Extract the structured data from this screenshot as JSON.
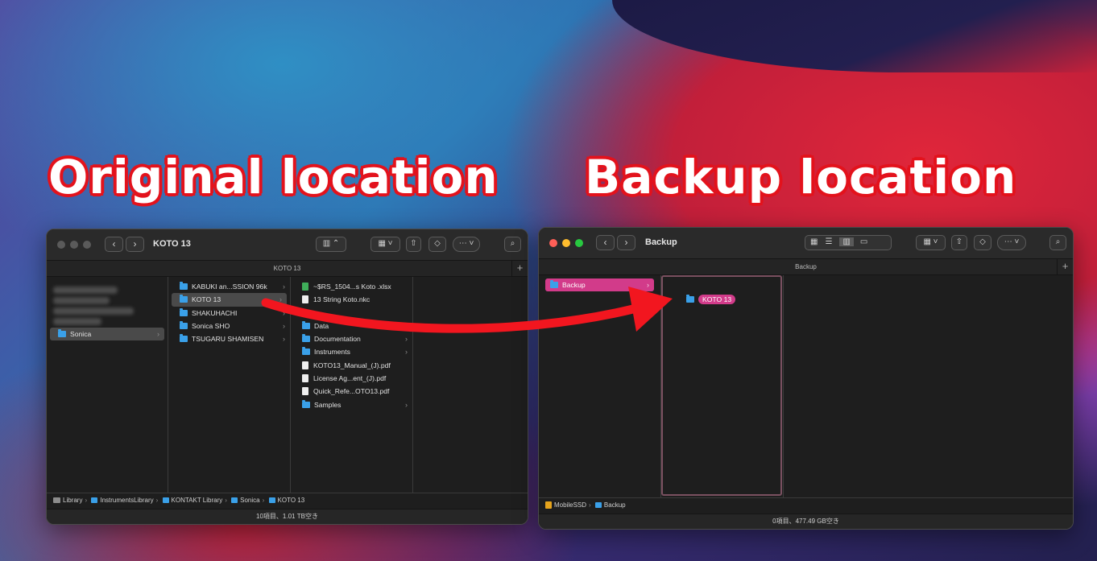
{
  "headings": {
    "original": "Original location",
    "backup": "Backup location"
  },
  "colors": {
    "heading_outline": "#e3121c",
    "arrow": "#f2161f",
    "folder": "#3aa0e8",
    "selection_pink": "#d23b8a",
    "traffic_red": "#ff5f57",
    "traffic_yellow": "#febc2e",
    "traffic_green": "#28c840"
  },
  "original_window": {
    "title": "KOTO 13",
    "tab_label": "KOTO 13",
    "sidebar_selected": "Sonica",
    "column2": [
      {
        "label": "KABUKI an...SSION 96k",
        "icon": "folder-icon",
        "has_children": true
      },
      {
        "label": "KOTO 13",
        "icon": "folder-icon",
        "has_children": true,
        "selected": true
      },
      {
        "label": "SHAKUHACHI",
        "icon": "folder-icon",
        "has_children": true
      },
      {
        "label": "Sonica SHO",
        "icon": "folder-icon",
        "has_children": true
      },
      {
        "label": "TSUGARU SHAMISEN",
        "icon": "folder-icon",
        "has_children": true
      }
    ],
    "column3": [
      {
        "label": "~$RS_1504...s Koto .xlsx",
        "icon": "xlsx-icon",
        "has_children": false
      },
      {
        "label": "13 String Koto.nkc",
        "icon": "document-icon",
        "has_children": false
      },
      {
        "label": "",
        "icon": "",
        "has_children": false
      },
      {
        "label": "Data",
        "icon": "folder-icon",
        "has_children": false
      },
      {
        "label": "Documentation",
        "icon": "folder-icon",
        "has_children": true
      },
      {
        "label": "Instruments",
        "icon": "folder-icon",
        "has_children": true
      },
      {
        "label": "KOTO13_Manual_(J).pdf",
        "icon": "pdf-icon",
        "has_children": false
      },
      {
        "label": "License Ag...ent_(J).pdf",
        "icon": "pdf-icon",
        "has_children": false
      },
      {
        "label": "Quick_Refe...OTO13.pdf",
        "icon": "pdf-icon",
        "has_children": false
      },
      {
        "label": "Samples",
        "icon": "folder-icon",
        "has_children": true
      }
    ],
    "path": [
      "Library",
      "InstrumentsLibrary",
      "KONTAKT Library",
      "Sonica",
      "KOTO 13"
    ],
    "status": "10項目、1.01 TB空き"
  },
  "backup_window": {
    "title": "Backup",
    "tab_label": "Backup",
    "sidebar_selected": "Backup",
    "dragged_item": "KOTO 13",
    "path": [
      "MobileSSD",
      "Backup"
    ],
    "status": "0項目、477.49 GB空き"
  },
  "icons": {
    "back": "chevron-left-icon",
    "forward": "chevron-right-icon",
    "view": "column-view-icon",
    "group": "group-icon",
    "share": "share-icon",
    "tag": "tag-icon",
    "action": "ellipsis-icon",
    "search": "search-icon",
    "new_tab": "plus-icon"
  }
}
